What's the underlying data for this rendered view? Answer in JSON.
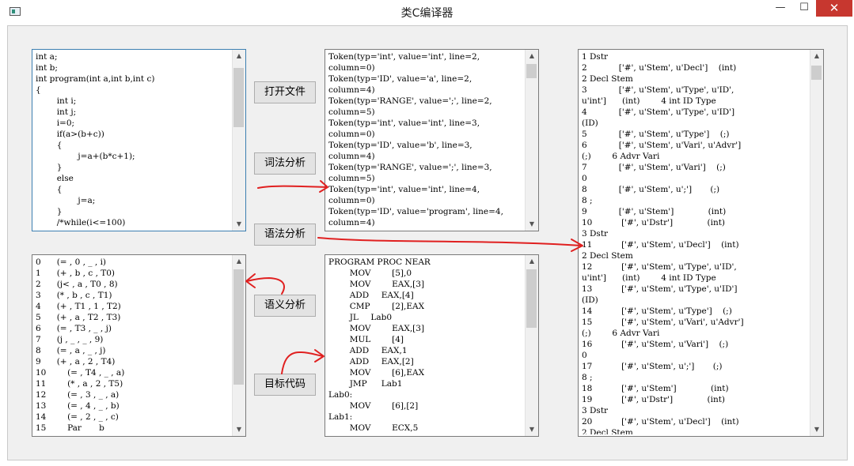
{
  "window": {
    "title": "类C编译器",
    "minimize_glyph": "—",
    "maximize_glyph": "☐",
    "close_glyph": "✕"
  },
  "buttons": {
    "open_file": "打开文件",
    "lexical": "词法分析",
    "syntax": "语法分析",
    "semantic": "语义分析",
    "target_code": "目标代码"
  },
  "source_code": "int a;\nint b;\nint program(int a,int b,int c)\n{\n\t\tint i;\n\t\tint j;\n\t\ti=0;\n\t\tif(a>(b+c))\n\t\t{\n\t\t\t\tj=a+(b*c+1);\n\t\t}\n\t\telse\n\t\t{\n\t\t\t\tj=a;\n\t\t}\n\t\t/*while(i<=100)\n\t\t{",
  "tokens": "Token(typ='int', value='int', line=2,\ncolumn=0)\nToken(typ='ID', value='a', line=2,\ncolumn=4)\nToken(typ='RANGE', value=';', line=2,\ncolumn=5)\nToken(typ='int', value='int', line=3,\ncolumn=0)\nToken(typ='ID', value='b', line=3,\ncolumn=4)\nToken(typ='RANGE', value=';', line=3,\ncolumn=5)\nToken(typ='int', value='int', line=4,\ncolumn=0)\nToken(typ='ID', value='program', line=4,\ncolumn=4)",
  "syntax_output": "1 Dstr\n2            ['#', u'Stem', u'Decl']    (int)\n2 Decl Stem\n3            ['#', u'Stem', u'Type', u'ID',\nu'int']      (int)        4 int ID Type\n4            ['#', u'Stem', u'Type', u'ID']\n(ID)\n5            ['#', u'Stem', u'Type']    (;)\n6            ['#', u'Stem', u'Vari', u'Advr']\n(;)        6 Advr Vari\n7            ['#', u'Stem', u'Vari']    (;)\n0\n8            ['#', u'Stem', u';']       (;)\n8 ;\n9            ['#', u'Stem']             (int)\n10           ['#', u'Dstr']             (int)\n3 Dstr\n11           ['#', u'Stem', u'Decl']    (int)\n2 Decl Stem\n12           ['#', u'Stem', u'Type', u'ID',\nu'int']      (int)        4 int ID Type\n13           ['#', u'Stem', u'Type', u'ID']\n(ID)\n14           ['#', u'Stem', u'Type']    (;)\n15           ['#', u'Stem', u'Vari', u'Advr']\n(;)        6 Advr Vari\n16           ['#', u'Stem', u'Vari']    (;)\n0\n17           ['#', u'Stem', u';']       (;)\n8 ;\n18           ['#', u'Stem']             (int)\n19           ['#', u'Dstr']             (int)\n3 Dstr\n20           ['#', u'Stem', u'Decl']    (int)\n2 Decl Stem",
  "quadruples": "0\t\t(= , 0 , _ , i)\n1\t\t(+ , b , c , T0)\n2\t\t(j< , a , T0 , 8)\n3\t\t(* , b , c , T1)\n4\t\t(+ , T1 , 1 , T2)\n5\t\t(+ , a , T2 , T3)\n6\t\t(= , T3 , _ , j)\n7\t\t(j , _ , _ , 9)\n8\t\t(= , a , _ , j)\n9\t\t(+ , a , 2 , T4)\n10\t\t(= , T4 , _ , a)\n11\t\t(* , a , 2 , T5)\n12\t\t(= , 3 , _ , a)\n13\t\t(= , 4 , _ , b)\n14\t\t(= , 2 , _ , c)\n15\t\tPar\t\tb",
  "target_asm": "PROGRAM PROC NEAR\n\t\tMOV\t\t[5],0\n\t\tMOV\t\tEAX,[3]\n\t\tADD\t\tEAX,[4]\n\t\tCMP\t\t[2],EAX\n\t\tJL\t\tLab0\n\t\tMOV\t\tEAX,[3]\n\t\tMUL\t\t[4]\n\t\tADD\t\tEAX,1\n\t\tADD\t\tEAX,[2]\n\t\tMOV\t\t[6],EAX\n\t\tJMP\t\tLab1\nLab0:\n\t\tMOV\t\t[6],[2]\nLab1:\n\t\tMOV\t\tECX,5",
  "colors": {
    "annotation_red": "#e02020",
    "close_red": "#c7372f",
    "focus_border": "#3c7fb1"
  }
}
